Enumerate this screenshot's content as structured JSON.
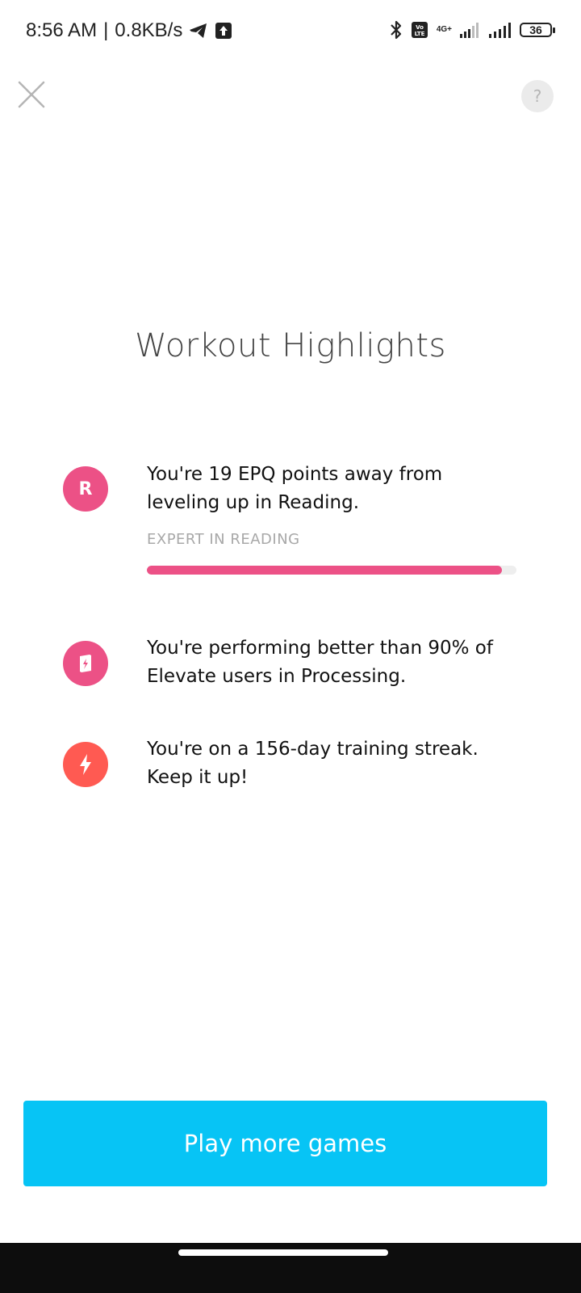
{
  "status_bar": {
    "time": "8:56 AM",
    "speed": "0.8KB/s",
    "network_top": "4G+",
    "volte": "Vo LTE",
    "battery": "36"
  },
  "header": {
    "help_label": "?"
  },
  "title": "Workout Highlights",
  "highlights": [
    {
      "icon": "letter-r-icon",
      "icon_label": "R",
      "icon_color": "#EC5186",
      "text_line1": "You're 19 EPQ points away from",
      "text_line2": "leveling up in Reading.",
      "sublabel": "EXPERT IN READING",
      "progress_fraction": 0.96,
      "progress_color": "#EC5186"
    },
    {
      "icon": "processing-book-icon",
      "icon_color": "#EC5186",
      "text_line1": "You're performing better than 90% of",
      "text_line2": "Elevate users in Processing."
    },
    {
      "icon": "lightning-icon",
      "icon_color": "#FF5A52",
      "text_line1": "You're on a 156-day training streak.",
      "text_line2": "Keep it up!"
    }
  ],
  "cta": {
    "label": "Play more games",
    "color": "#07C4F5"
  },
  "colors": {
    "background": "#FFFFFF",
    "nav_bar": "#0D0D0D"
  }
}
